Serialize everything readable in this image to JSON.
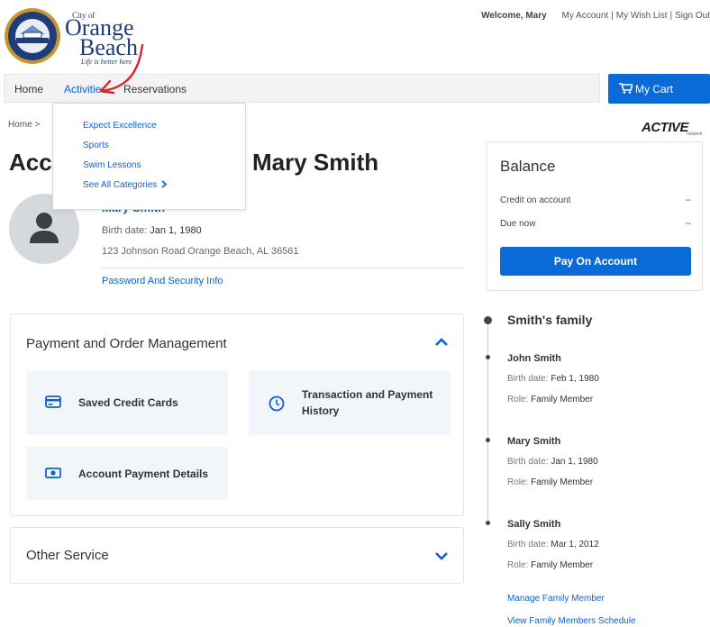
{
  "header": {
    "logo": {
      "city_of": "City of",
      "orange": "Orange",
      "beach": "Beach",
      "tagline": "Life is better here"
    },
    "welcome": "Welcome, Mary",
    "links": [
      "My Account",
      "My Wish List",
      "Sign Out"
    ]
  },
  "nav": {
    "items": [
      "Home",
      "Activities",
      "Reservations"
    ],
    "active": "Activities",
    "cart_label": "My Cart"
  },
  "dropdown": {
    "items": [
      "Expect Excellence",
      "Sports",
      "Swim Lessons",
      "See All Categories"
    ]
  },
  "breadcrumb": "Home >",
  "active_logo": {
    "brand": "ACTIVE",
    "sub": "network"
  },
  "page_title": "Acc         Mary Smith",
  "page_title_visible_right": "Mary Smith",
  "page_title_visible_left": "Acc",
  "profile": {
    "name": "Mary Smith",
    "birth_label": "Birth date:",
    "birth_value": "Jan 1, 1980",
    "address": "123 Johnson Road Orange Beach, AL 36561",
    "password_link": "Password And Security Info"
  },
  "payment_section": {
    "title": "Payment and Order Management",
    "tiles": [
      {
        "label": "Saved Credit Cards",
        "icon": "credit-card-icon"
      },
      {
        "label": "Transaction and Payment History",
        "icon": "clock-icon"
      },
      {
        "label": "Account Payment Details",
        "icon": "money-icon"
      }
    ]
  },
  "other_section": {
    "title": "Other Service"
  },
  "balance": {
    "title": "Balance",
    "rows": [
      {
        "label": "Credit on account",
        "value": "--"
      },
      {
        "label": "Due now",
        "value": "--"
      }
    ],
    "pay_button": "Pay On Account"
  },
  "family": {
    "title": "Smith's family",
    "birth_label": "Birth date:",
    "role_label": "Role:",
    "members": [
      {
        "name": "John Smith",
        "birth": "Feb 1, 1980",
        "role": "Family Member"
      },
      {
        "name": "Mary Smith",
        "birth": "Jan 1, 1980",
        "role": "Family Member"
      },
      {
        "name": "Sally Smith",
        "birth": "Mar 1, 2012",
        "role": "Family Member"
      }
    ],
    "manage_link": "Manage Family Member",
    "schedule_link": "View Family Members Schedule"
  },
  "colors": {
    "primary": "#0b6bd6",
    "link": "#0b62d6",
    "annotation": "#d9262c"
  }
}
